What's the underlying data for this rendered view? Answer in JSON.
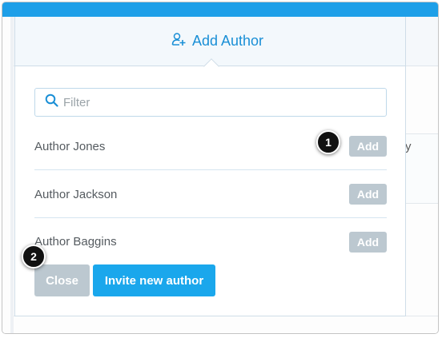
{
  "colors": {
    "top_bar": "#1e9fe8",
    "title": "#1a8fd6",
    "primary_button": "#1aa7ec",
    "disabled_button": "#bcc8d0",
    "callout": "#111111"
  },
  "background": {
    "partial_text": "y"
  },
  "dialog": {
    "icon": "add-user-icon",
    "title": "Add Author",
    "filter": {
      "icon": "search-icon",
      "placeholder": "Filter",
      "value": ""
    },
    "authors": [
      {
        "name": "Author Jones",
        "action": "Add"
      },
      {
        "name": "Author Jackson",
        "action": "Add"
      },
      {
        "name": "Author Baggins",
        "action": "Add"
      }
    ],
    "close_label": "Close",
    "invite_label": "Invite new author"
  },
  "callouts": [
    "1",
    "2"
  ]
}
